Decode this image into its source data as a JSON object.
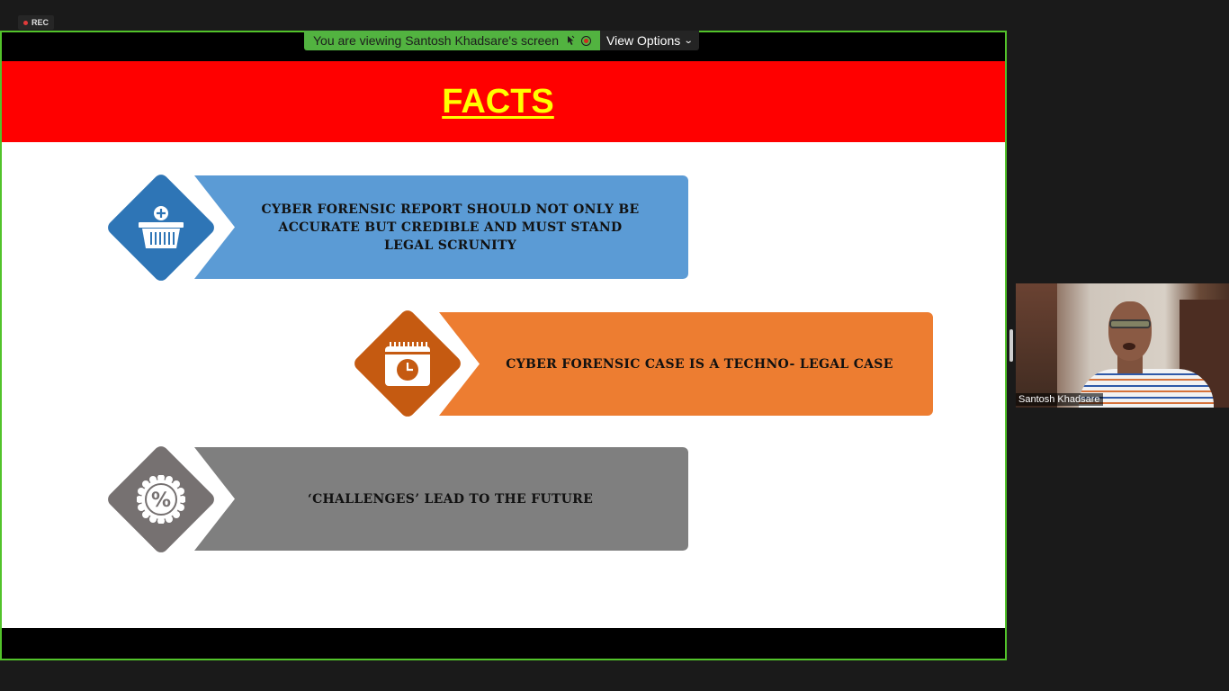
{
  "recording": {
    "label": "REC"
  },
  "share_banner": {
    "viewing_text": "You are viewing Santosh Khadsare's screen",
    "view_options_label": "View Options"
  },
  "slide": {
    "title": "FACTS",
    "header_color": "#ff0000",
    "title_color": "#ffff00",
    "facts": [
      {
        "text": "CYBER FORENSIC REPORT SHOULD NOT ONLY BE ACCURATE BUT CREDIBLE  AND MUST STAND LEGAL SCRUNITY",
        "color": "#5b9bd5",
        "icon_color": "#2e75b6",
        "icon": "shopping-basket-icon"
      },
      {
        "text": "CYBER FORENSIC CASE IS A TECHNO- LEGAL CASE",
        "color": "#ed7d31",
        "icon_color": "#c55a11",
        "icon": "calendar-clock-icon"
      },
      {
        "text": "‘CHALLENGES’ LEAD TO THE FUTURE",
        "color": "#7f7f7f",
        "icon_color": "#767171",
        "icon": "percent-badge-icon"
      }
    ]
  },
  "participant": {
    "name": "Santosh Khadsare"
  },
  "colors": {
    "frame_border": "#52c32a",
    "banner_bg": "#52b340"
  }
}
